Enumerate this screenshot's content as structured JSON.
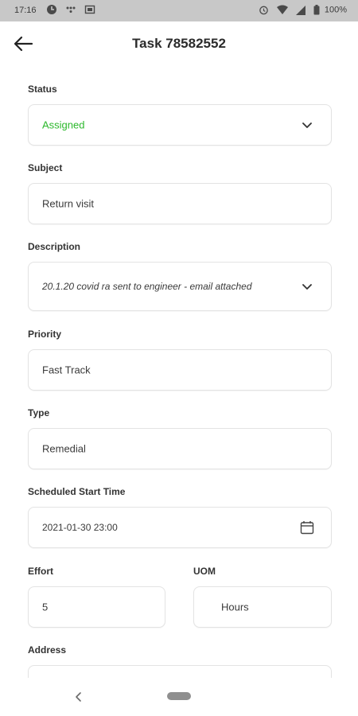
{
  "status_bar": {
    "time": "17:16",
    "battery": "100%",
    "left_icons": [
      "data-saver-icon",
      "dots-icon",
      "screen-icon"
    ],
    "right_icons": [
      "alarm-icon",
      "wifi-icon",
      "signal-icon",
      "battery-icon"
    ]
  },
  "header": {
    "title": "Task 78582552",
    "back_icon": "arrow-left-icon"
  },
  "form": {
    "status": {
      "label": "Status",
      "value": "Assigned",
      "value_color": "#2bb82b",
      "icon": "chevron-down-icon"
    },
    "subject": {
      "label": "Subject",
      "value": "Return visit"
    },
    "description": {
      "label": "Description",
      "value": "20.1.20 covid ra sent to engineer - email attached",
      "icon": "chevron-down-icon"
    },
    "priority": {
      "label": "Priority",
      "value": "Fast Track"
    },
    "type": {
      "label": "Type",
      "value": "Remedial"
    },
    "scheduled_start": {
      "label": "Scheduled Start Time",
      "value": "2021-01-30 23:00",
      "icon": "calendar-icon"
    },
    "effort": {
      "label": "Effort",
      "value": "5"
    },
    "uom": {
      "label": "UOM",
      "value": "Hours"
    },
    "address": {
      "label": "Address",
      "value": ""
    }
  },
  "nav_bar": {
    "back_icon": "nav-back-icon",
    "home_icon": "home-pill-icon"
  }
}
